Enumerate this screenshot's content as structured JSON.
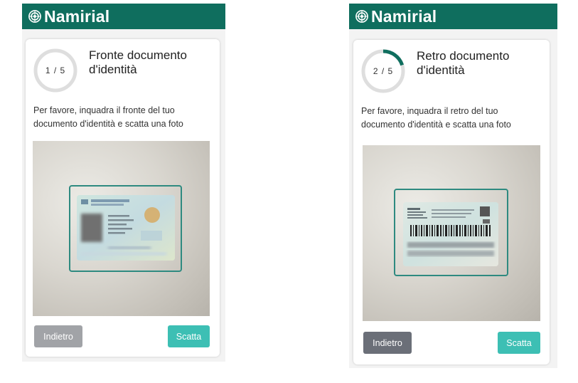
{
  "colors": {
    "brand": "#0f6e5e",
    "accent": "#3dbfb4",
    "frame": "#2e8a80",
    "progress_track": "#dedede",
    "progress_fill": "#0f6e5e",
    "back_disabled": "#a1a3a7",
    "back_enabled": "#6b6f78"
  },
  "screens": [
    {
      "brand": "Namirial",
      "logo_icon": "namirial-logo-icon",
      "progress": {
        "label": "1 / 5",
        "value": 0
      },
      "title": "Fronte documento d'identità",
      "description": "Per favore, inquadra il fronte del tuo documento d'identità e scatta una foto",
      "back_label": "Indietro",
      "back_enabled": false,
      "shoot_label": "Scatta"
    },
    {
      "brand": "Namirial",
      "logo_icon": "namirial-logo-icon",
      "progress": {
        "label": "2 / 5",
        "value": 0.2
      },
      "title": "Retro documento d'identità",
      "description": "Per favore, inquadra il retro del tuo documento d'identità e scatta una foto",
      "back_label": "Indietro",
      "back_enabled": true,
      "shoot_label": "Scatta"
    }
  ]
}
